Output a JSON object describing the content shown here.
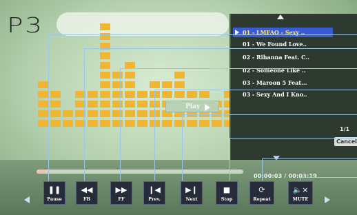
{
  "logo": "P3",
  "playlist": {
    "items": [
      "01 - LMFAO - Sexy ..",
      "01 - We Found Love..",
      "02 - Rihanna Feat. C..",
      "02 - Someone Like ..",
      "03 - Maroon 5 Feat...",
      "03 - Sexy And I Kno.."
    ],
    "selected_index": 0,
    "page_indicator": "1/1",
    "cancel_label": "Cancel"
  },
  "center": {
    "play_label": "Play"
  },
  "equalizer": {
    "columns": [
      5,
      4,
      2,
      4,
      4,
      11,
      6,
      7,
      4,
      5,
      5,
      6,
      4,
      4,
      3,
      4
    ]
  },
  "progress": {
    "fraction": 0.06,
    "time_text": "00:00:03 / 00:03:19"
  },
  "controls": [
    {
      "id": "pause",
      "label": "Pause",
      "icon": "pause-icon"
    },
    {
      "id": "fb",
      "label": "FB",
      "icon": "fast-backward-icon"
    },
    {
      "id": "ff",
      "label": "FF",
      "icon": "fast-forward-icon"
    },
    {
      "id": "prev",
      "label": "Prev.",
      "icon": "previous-icon"
    },
    {
      "id": "next",
      "label": "Next",
      "icon": "next-icon"
    },
    {
      "id": "stop",
      "label": "Stop",
      "icon": "stop-icon"
    },
    {
      "id": "repeat",
      "label": "Repeat",
      "icon": "repeat-icon"
    },
    {
      "id": "mute",
      "label": "MUTE",
      "icon": "mute-icon"
    }
  ],
  "colors": {
    "accent": "#f2b531",
    "selection": "#3b5bd6",
    "selected_text": "#ffe96a",
    "callout": "#9bc6e6"
  }
}
